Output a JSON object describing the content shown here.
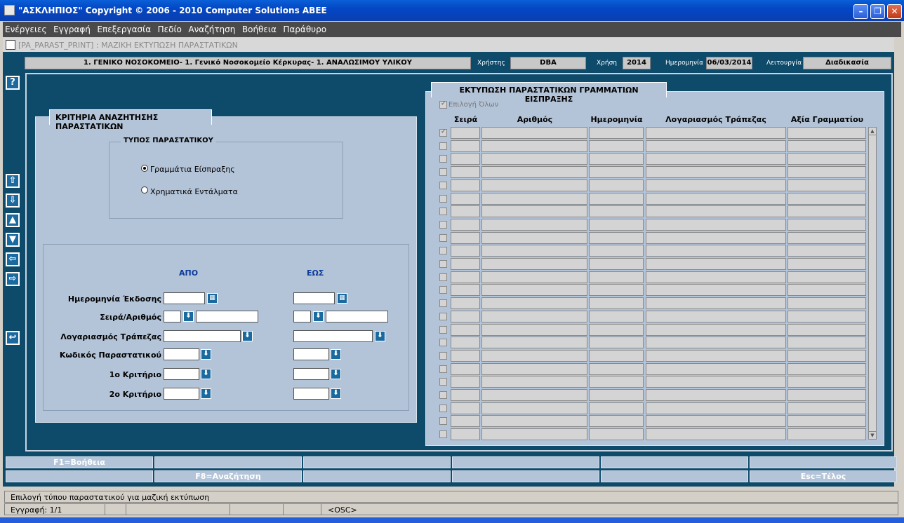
{
  "window": {
    "title": "\"ΑΣΚΛΗΠΙΟΣ\" Copyright © 2006 - 2010 Computer Solutions ABEE"
  },
  "menu": [
    "Ενέργειες",
    "Εγγραφή",
    "Επεξεργασία",
    "Πεδίο",
    "Αναζήτηση",
    "Βοήθεια",
    "Παράθυρο"
  ],
  "form": {
    "title": "[PA_PARAST_PRINT]  :  ΜΑΖΙΚΗ ΕΚΤΥΠΩΣΗ ΠΑΡΑΣΤΑΤΙΚΩΝ"
  },
  "header": {
    "hospital": "1. ΓΕΝΙΚΟ ΝΟΣΟΚΟΜΕΙΟ- 1. Γενικό Νοσοκομείο Κέρκυρας- 1. ΑΝΑΛΩΣΙΜΟΥ ΥΛΙΚΟΥ",
    "user_label": "Χρήστης",
    "user": "DBA",
    "year_label": "Χρήση",
    "year": "2014",
    "date_label": "Ημερομηνία",
    "date": "06/03/2014",
    "mode_label": "Λειτουργία",
    "mode": "Διαδικασία"
  },
  "search": {
    "title": "ΚΡΙΤΗΡΙΑ ΑΝΑΖΗΤΗΣΗΣ ΠΑΡΑΣΤΑΤΙΚΩΝ",
    "type_title": "ΤΥΠΟΣ ΠΑΡΑΣΤΑΤΙΚΟΥ",
    "radio1": "Γραμμάτια Είσπραξης",
    "radio2": "Χρηματικά Εντάλματα",
    "from": "ΑΠΟ",
    "to": "ΕΩΣ",
    "issue_date": "Ημερομηνία Έκδοσης",
    "series_number": "Σειρά/Αριθμός",
    "bank_account": "Λογαριασμός Τράπεζας",
    "doc_code": "Κωδικός Παραστατικού",
    "criterion1": "1ο Κριτήριο",
    "criterion2": "2ο Κριτήριο"
  },
  "grid": {
    "title": "ΕΚΤΥΠΩΣΗ ΠΑΡΑΣΤΑΤΙΚΩΝ ΓΡΑΜΜΑΤΙΩΝ ΕΙΣΠΡΑΞΗΣ",
    "select_all": "Επιλογή Όλων",
    "columns": [
      "Σειρά",
      "Αριθμός",
      "Ημερομηνία",
      "Λογαριασμός Τράπεζας",
      "Αξία Γραμματίου"
    ]
  },
  "fkeys": {
    "row1": [
      "F1=Βοήθεια",
      "",
      "",
      "",
      "",
      ""
    ],
    "row2": [
      "",
      "F8=Αναζήτηση",
      "",
      "",
      "",
      "Esc=Τέλος"
    ]
  },
  "status": {
    "message": "Επιλογή τύπου παραστατικού για μαζική εκτύπωση",
    "record": "Εγγραφή: 1/1",
    "osc": "<OSC>"
  },
  "icons": {
    "help": "question-icon",
    "nav": [
      "first-record-icon",
      "last-record-icon",
      "previous-record-icon",
      "next-record-icon",
      "previous-block-icon",
      "next-block-icon",
      "exit-icon"
    ]
  }
}
